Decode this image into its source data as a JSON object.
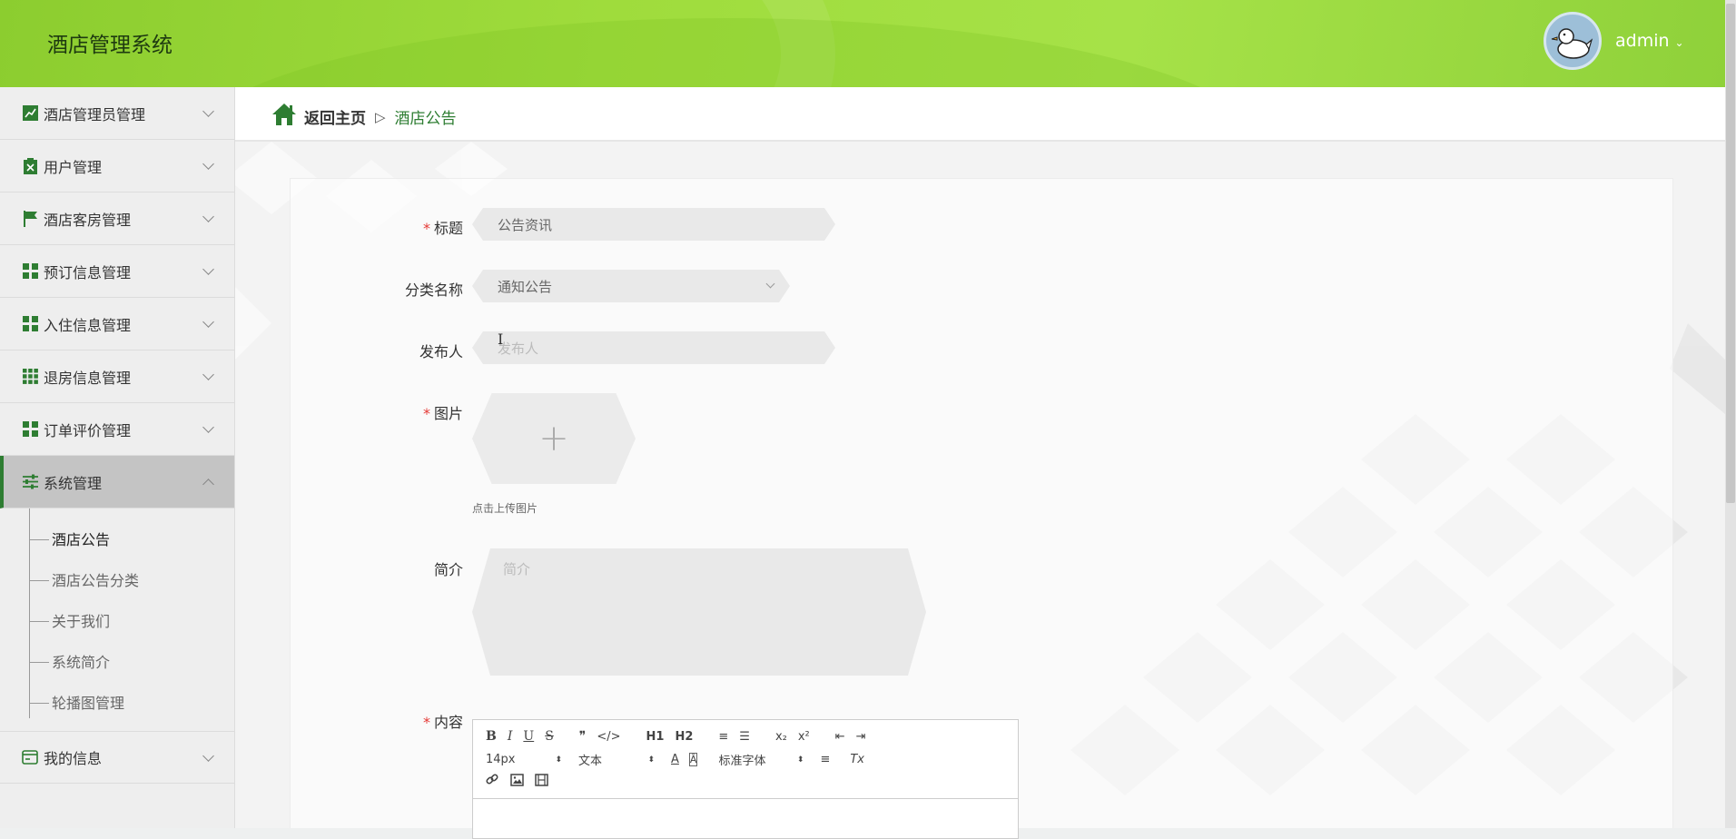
{
  "header": {
    "app_title": "酒店管理系统",
    "user_name": "admin",
    "user_caret": "⌄",
    "avatar_icon": "duck-avatar"
  },
  "sidebar": {
    "items": [
      {
        "label": "酒店管理员管理",
        "icon": "chart-line-icon"
      },
      {
        "label": "用户管理",
        "icon": "clipboard-x-icon"
      },
      {
        "label": "酒店客房管理",
        "icon": "flag-icon"
      },
      {
        "label": "预订信息管理",
        "icon": "grid-icon"
      },
      {
        "label": "入住信息管理",
        "icon": "grid-icon"
      },
      {
        "label": "退房信息管理",
        "icon": "grid-nine-icon"
      },
      {
        "label": "订单评价管理",
        "icon": "grid-icon"
      },
      {
        "label": "系统管理",
        "icon": "sliders-icon",
        "active": true
      }
    ],
    "submenu": [
      {
        "label": "酒店公告",
        "active": true
      },
      {
        "label": "酒店公告分类"
      },
      {
        "label": "关于我们"
      },
      {
        "label": "系统简介"
      },
      {
        "label": "轮播图管理"
      }
    ],
    "bottom_item": {
      "label": "我的信息",
      "icon": "card-icon"
    }
  },
  "breadcrumb": {
    "home": "返回主页",
    "separator": "▷",
    "current": "酒店公告"
  },
  "form": {
    "title": {
      "label": "标题",
      "required": true,
      "value": "公告资讯"
    },
    "category": {
      "label": "分类名称",
      "value": "通知公告"
    },
    "publisher": {
      "label": "发布人",
      "placeholder": "发布人"
    },
    "image": {
      "label": "图片",
      "required": true,
      "plus": "+",
      "tip": "点击上传图片"
    },
    "intro": {
      "label": "简介",
      "placeholder": "简介"
    },
    "content": {
      "label": "内容",
      "required": true
    }
  },
  "editor": {
    "row1": [
      "B",
      "I",
      "U",
      "S",
      "❞",
      "</>",
      "H1",
      "H2",
      "≡",
      "☰",
      "x₂",
      "x²",
      "⇤",
      "⇥"
    ],
    "font_size": "14px",
    "header_select": "文本",
    "font_family": "标准字体",
    "row2_icons": [
      "A",
      "Ā",
      "≡",
      "Tx"
    ],
    "row3_icons": [
      "link-icon",
      "image-icon",
      "video-icon"
    ]
  },
  "colors": {
    "brand_green": "#2e7d32",
    "header_green": "#9fdc3c",
    "required_red": "#e53935"
  }
}
